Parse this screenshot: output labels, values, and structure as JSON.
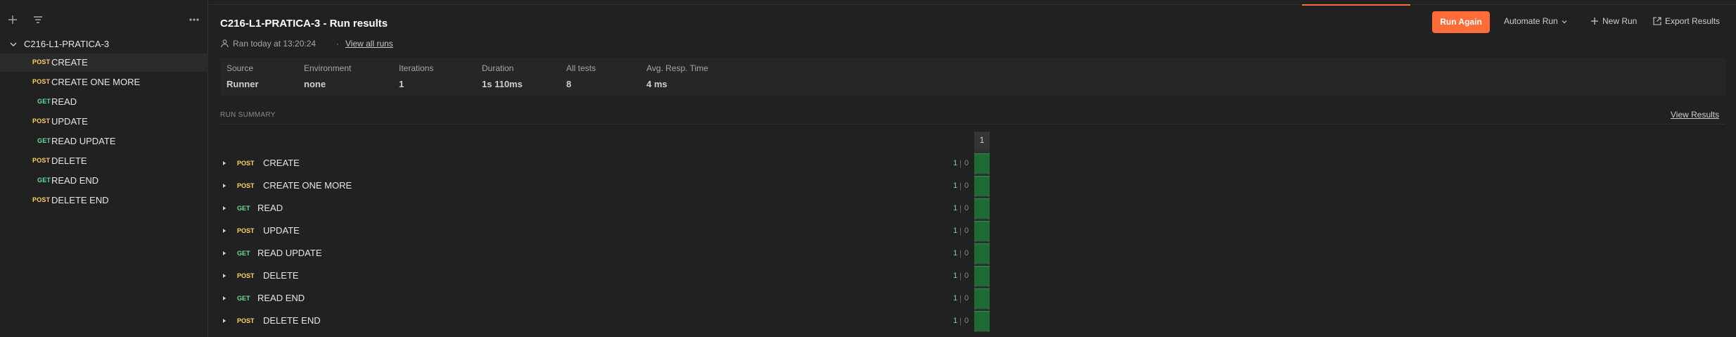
{
  "sidebar": {
    "collection_name": "C216-L1-PRATICA-3",
    "requests": [
      {
        "method": "POST",
        "name": "CREATE"
      },
      {
        "method": "POST",
        "name": "CREATE ONE MORE"
      },
      {
        "method": "GET",
        "name": "READ"
      },
      {
        "method": "POST",
        "name": "UPDATE"
      },
      {
        "method": "GET",
        "name": "READ UPDATE"
      },
      {
        "method": "POST",
        "name": "DELETE"
      },
      {
        "method": "GET",
        "name": "READ END"
      },
      {
        "method": "POST",
        "name": "DELETE END"
      }
    ],
    "icons": [
      "plus-icon",
      "filter-icon",
      "more-icon",
      "chevron-down-icon"
    ]
  },
  "header": {
    "title": "C216-L1-PRATICA-3 - Run results",
    "ran_text": "Ran today at 13:20:24",
    "separator": "·",
    "view_all_runs": "View all runs",
    "run_again": "Run Again",
    "automate_run": "Automate Run",
    "new_run": "New Run",
    "export_results": "Export Results"
  },
  "stats": [
    {
      "label": "Source",
      "value": "Runner"
    },
    {
      "label": "Environment",
      "value": "none"
    },
    {
      "label": "Iterations",
      "value": "1"
    },
    {
      "label": "Duration",
      "value": "1s 110ms"
    },
    {
      "label": "All tests",
      "value": "8"
    },
    {
      "label": "Avg. Resp. Time",
      "value": "4 ms"
    }
  ],
  "summary": {
    "heading": "RUN SUMMARY",
    "view_results": "View Results",
    "iteration_header": "1",
    "rows": [
      {
        "method": "POST",
        "name": "CREATE",
        "passed": "1",
        "sep": "|",
        "failed": "0"
      },
      {
        "method": "POST",
        "name": "CREATE ONE MORE",
        "passed": "1",
        "sep": "|",
        "failed": "0"
      },
      {
        "method": "GET",
        "name": "READ",
        "passed": "1",
        "sep": "|",
        "failed": "0"
      },
      {
        "method": "POST",
        "name": "UPDATE",
        "passed": "1",
        "sep": "|",
        "failed": "0"
      },
      {
        "method": "GET",
        "name": "READ UPDATE",
        "passed": "1",
        "sep": "|",
        "failed": "0"
      },
      {
        "method": "POST",
        "name": "DELETE",
        "passed": "1",
        "sep": "|",
        "failed": "0"
      },
      {
        "method": "GET",
        "name": "READ END",
        "passed": "1",
        "sep": "|",
        "failed": "0"
      },
      {
        "method": "POST",
        "name": "DELETE END",
        "passed": "1",
        "sep": "|",
        "failed": "0"
      }
    ]
  },
  "colors": {
    "accent": "#ff6c37",
    "post": "#ffd166",
    "get": "#6bdd9a",
    "pass_cell": "#1e6b34"
  }
}
